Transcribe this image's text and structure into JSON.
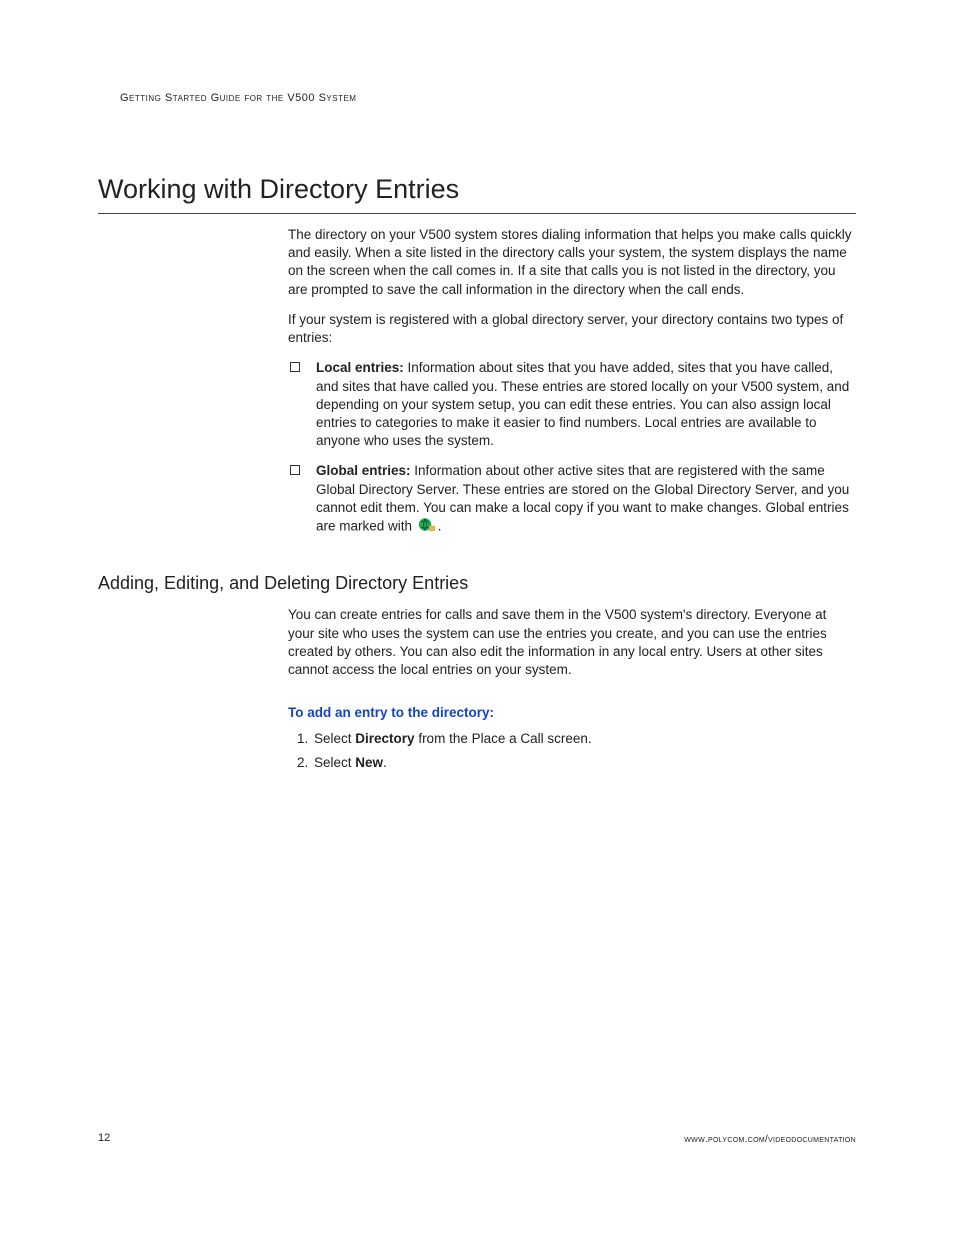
{
  "header": {
    "running_head": "Getting Started Guide for the V500 System"
  },
  "section": {
    "title": "Working with Directory Entries",
    "intro1": "The directory on your V500 system stores dialing information that helps you make calls quickly and easily. When a site listed in the directory calls your system, the system displays the name on the screen when the call comes in. If a site that calls you is not listed in the directory, you are prompted to save the call information in the directory when the call ends.",
    "intro2": "If your system is registered with a global directory server, your directory contains two types of entries:",
    "bullets": [
      {
        "label": "Local entries:",
        "text": " Information about sites that you have added, sites that you have called, and sites that have called you. These entries are stored locally on your V500 system, and depending on your system setup, you can edit these entries. You can also assign local entries to categories to make it easier to find numbers. Local entries are available to anyone who uses the system."
      },
      {
        "label": "Global entries:",
        "text_before_icon": " Information about other active sites that are registered with the same Global Directory Server. These entries are stored on the Global Directory Server, and you cannot edit them. You can make a local copy if you want to make changes. Global entries are marked with ",
        "text_after_icon": "."
      }
    ]
  },
  "subsection": {
    "title": "Adding, Editing, and Deleting Directory Entries",
    "para": "You can create entries for calls and save them in the V500 system's directory. Everyone at your site who uses the system can use the entries you create, and you can use the entries created by others. You can also edit the information in any local entry. Users at other sites cannot access the local entries on your system.",
    "task_head": "To add an entry to the directory:",
    "steps": {
      "s1_pre": "Select ",
      "s1_bold": "Directory",
      "s1_post": " from the Place a Call screen.",
      "s2_pre": "Select ",
      "s2_bold": "New",
      "s2_post": "."
    }
  },
  "footer": {
    "page_number": "12",
    "url": "www.polycom.com/videodocumentation"
  }
}
